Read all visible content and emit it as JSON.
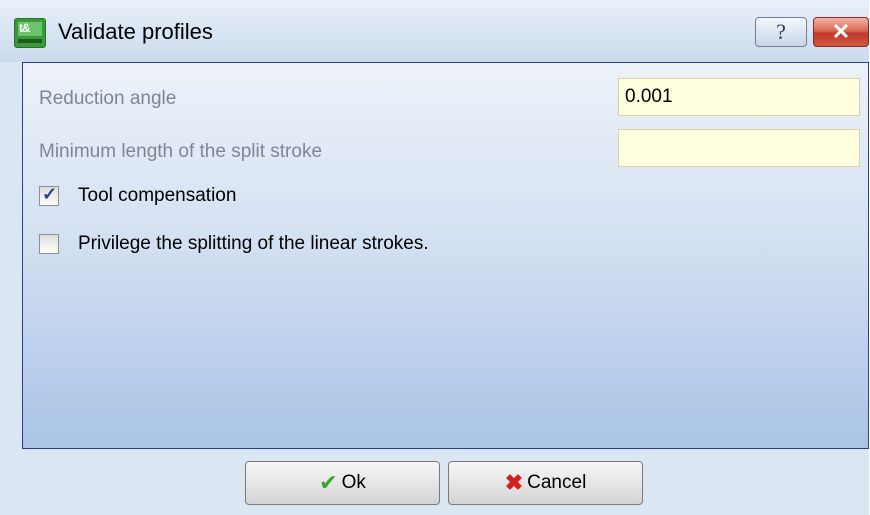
{
  "window": {
    "title": "Validate profiles",
    "help_label": "?",
    "close_label": "✕"
  },
  "form": {
    "reduction_angle": {
      "label": "Reduction angle",
      "value": "0.001"
    },
    "min_split_length": {
      "label": "Minimum length of the split stroke",
      "value": ""
    },
    "tool_compensation": {
      "label": "Tool compensation",
      "checked": true
    },
    "privilege_splitting": {
      "label": "Privilege the splitting of the linear strokes.",
      "checked": false
    }
  },
  "footer": {
    "ok_label": "Ok",
    "cancel_label": "Cancel"
  },
  "icons": {
    "app": "app-icon",
    "ok": "checkmark-icon",
    "cancel": "red-x-icon"
  },
  "colors": {
    "field_background": "#ffffe0",
    "content_border": "#2b3f8a",
    "disabled_text": "#7d8792"
  }
}
